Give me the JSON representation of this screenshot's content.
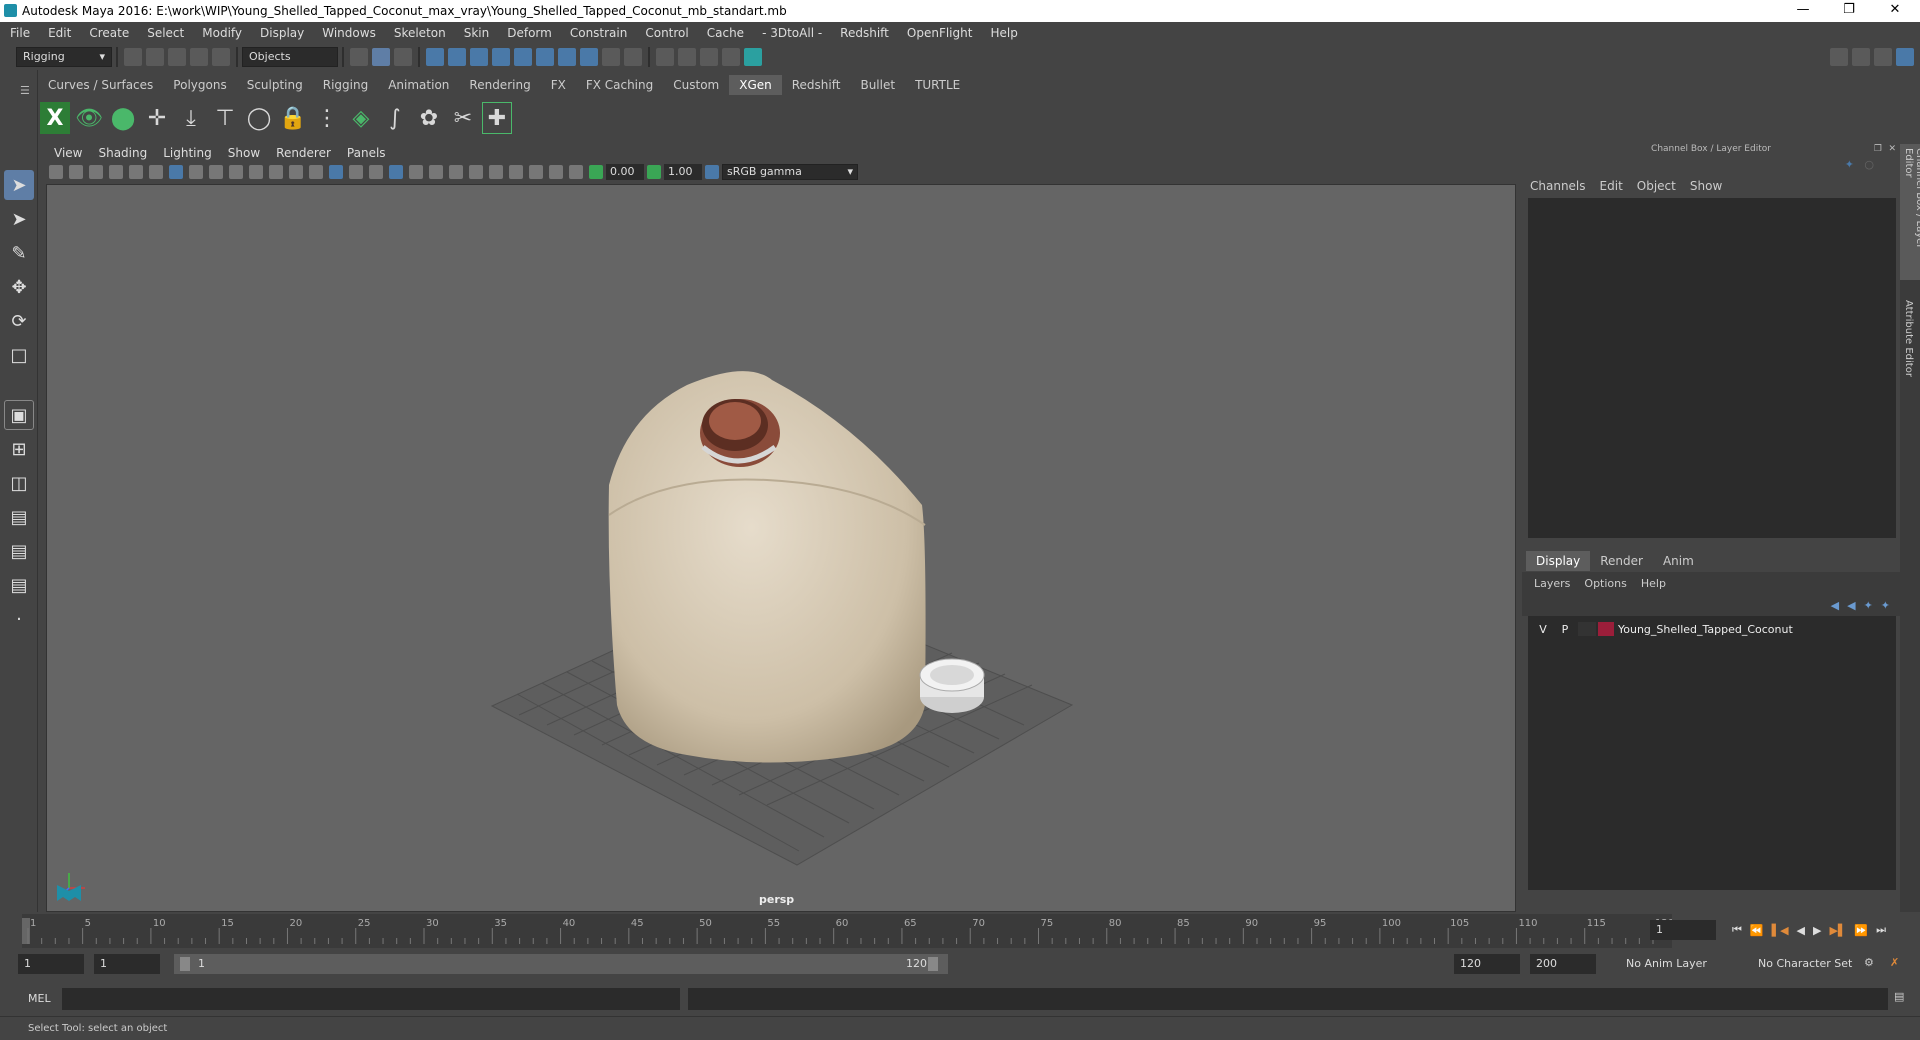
{
  "window": {
    "title": "Autodesk Maya 2016: E:\\work\\WIP\\Young_Shelled_Tapped_Coconut_max_vray\\Young_Shelled_Tapped_Coconut_mb_standart.mb"
  },
  "menubar": [
    "File",
    "Edit",
    "Create",
    "Select",
    "Modify",
    "Display",
    "Windows",
    "Skeleton",
    "Skin",
    "Deform",
    "Constrain",
    "Control",
    "Cache",
    "- 3DtoAll -",
    "Redshift",
    "OpenFlight",
    "Help"
  ],
  "statusline": {
    "menuset": "Rigging",
    "selection_mode": "Objects"
  },
  "shelf": {
    "tabs": [
      "Curves / Surfaces",
      "Polygons",
      "Sculpting",
      "Rigging",
      "Animation",
      "Rendering",
      "FX",
      "FX Caching",
      "Custom",
      "XGen",
      "Redshift",
      "Bullet",
      "TURTLE"
    ],
    "active_tab": "XGen"
  },
  "viewport": {
    "menu": [
      "View",
      "Shading",
      "Lighting",
      "Show",
      "Renderer",
      "Panels"
    ],
    "exposure": "0.00",
    "gamma": "1.00",
    "color_space": "sRGB gamma",
    "camera_label": "persp"
  },
  "channelbox": {
    "title": "Channel Box / Layer Editor",
    "menu": [
      "Channels",
      "Edit",
      "Object",
      "Show"
    ]
  },
  "layer_editor": {
    "tabs": [
      "Display",
      "Render",
      "Anim"
    ],
    "active_tab": "Display",
    "menu": [
      "Layers",
      "Options",
      "Help"
    ],
    "layers": [
      {
        "v": "V",
        "p": "P",
        "name": "Young_Shelled_Tapped_Coconut",
        "color": "#9b1e3a"
      }
    ]
  },
  "side_tabs": [
    "Channel Box / Layer Editor",
    "Attribute Editor"
  ],
  "timeline": {
    "ticks": [
      "1",
      "5",
      "10",
      "15",
      "20",
      "25",
      "30",
      "35",
      "40",
      "45",
      "50",
      "55",
      "60",
      "65",
      "70",
      "75",
      "80",
      "85",
      "90",
      "95",
      "100",
      "105",
      "110",
      "115",
      "120"
    ],
    "current_frame": "1"
  },
  "range": {
    "start": "1",
    "playback_start": "1",
    "slider_start": "1",
    "slider_end": "120",
    "playback_end": "120",
    "end": "200",
    "anim_layer": "No Anim Layer",
    "character_set": "No Character Set"
  },
  "cmdline": {
    "label": "MEL"
  },
  "helpline": {
    "text": "Select Tool: select an object"
  }
}
